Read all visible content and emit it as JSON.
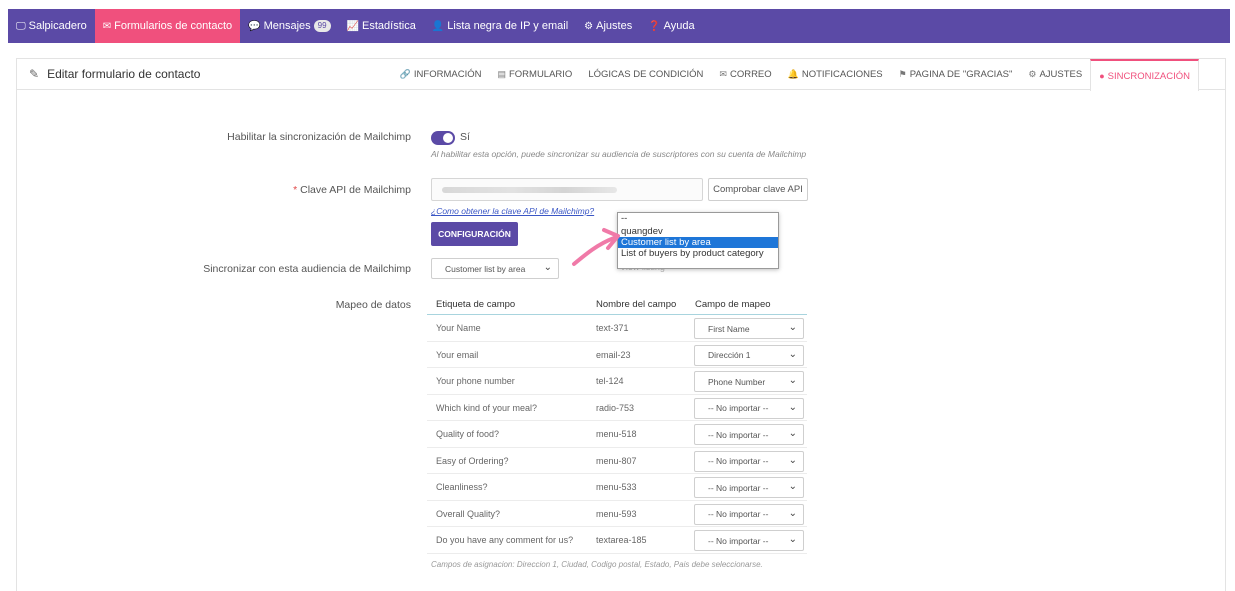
{
  "topnav": {
    "items": [
      {
        "label": "Salpicadero",
        "icon": "monitor-icon",
        "glyph": "🖵"
      },
      {
        "label": "Formularios de contacto",
        "icon": "envelope-icon",
        "glyph": "✉"
      },
      {
        "label": "Mensajes",
        "icon": "chat-icon",
        "glyph": "💬",
        "badge": "99"
      },
      {
        "label": "Estadística",
        "icon": "chart-icon",
        "glyph": "📈"
      },
      {
        "label": "Lista negra de IP y email",
        "icon": "user-block-icon",
        "glyph": "👤"
      },
      {
        "label": "Ajustes",
        "icon": "gear-icon",
        "glyph": "⚙"
      },
      {
        "label": "Ayuda",
        "icon": "question-icon",
        "glyph": "❓"
      }
    ],
    "active_index": 1
  },
  "panel": {
    "title": "Editar formulario de contacto",
    "tabs": [
      {
        "label": "Información",
        "icon": "info-icon",
        "glyph": "🔗"
      },
      {
        "label": "Formulario",
        "icon": "form-icon",
        "glyph": "▤"
      },
      {
        "label": "Lógicas de condición",
        "icon": "",
        "glyph": ""
      },
      {
        "label": "Correo",
        "icon": "mail-icon",
        "glyph": "✉"
      },
      {
        "label": "Notificaciones",
        "icon": "bell-icon",
        "glyph": "🔔"
      },
      {
        "label": "Pagina de \"gracias\"",
        "icon": "flag-icon",
        "glyph": "⚑"
      },
      {
        "label": "Ajustes",
        "icon": "gear-icon",
        "glyph": "⚙"
      },
      {
        "label": "Sincronización",
        "icon": "mailchimp-icon",
        "glyph": "●"
      }
    ],
    "active_tab": 7
  },
  "form": {
    "enable_label": "Habilitar la sincronización de Mailchimp",
    "enable_value": "Sí",
    "enable_help": "Al habilitar esta opción, puede sincronizar su audiencia de suscriptores con su cuenta de Mailchimp",
    "api_label": "Clave API de Mailchimp",
    "api_required": "*",
    "check_button": "Comprobar clave API",
    "api_help_link": "¿Como obtener la clave API de Mailchimp?",
    "config_button": "CONFIGURACIÓN",
    "audience_label": "Sincronizar con esta audiencia de Mailchimp",
    "audience_selected": "Customer list by area",
    "audience_hint": "View listing",
    "mapping_label": "Mapeo de datos"
  },
  "dropdown": {
    "options": [
      "--",
      "quangdev",
      "Customer list by area",
      "List of buyers by product category"
    ],
    "selected_index": 2
  },
  "mapping": {
    "columns": [
      "Etiqueta de campo",
      "Nombre del campo",
      "Campo de mapeo"
    ],
    "rows": [
      {
        "label": "Your Name",
        "name": "text-371",
        "map": "First Name"
      },
      {
        "label": "Your email",
        "name": "email-23",
        "map": "Dirección 1"
      },
      {
        "label": "Your phone number",
        "name": "tel-124",
        "map": "Phone Number"
      },
      {
        "label": "Which kind of your meal?",
        "name": "radio-753",
        "map": "-- No importar --"
      },
      {
        "label": "Quality of food?",
        "name": "menu-518",
        "map": "-- No importar --"
      },
      {
        "label": "Easy of Ordering?",
        "name": "menu-807",
        "map": "-- No importar --"
      },
      {
        "label": "Cleanliness?",
        "name": "menu-533",
        "map": "-- No importar --"
      },
      {
        "label": "Overall Quality?",
        "name": "menu-593",
        "map": "-- No importar --"
      },
      {
        "label": "Do you have any comment for us?",
        "name": "textarea-185",
        "map": "-- No importar --"
      }
    ],
    "footnote": "Campos de asignacion: Direccion 1, Ciudad, Codigo postal, Estado, Pais debe seleccionarse."
  },
  "colors": {
    "brand": "#5b4aa6",
    "accent": "#f0507d",
    "selection": "#1e76d8",
    "arrow": "#f07aa8"
  }
}
